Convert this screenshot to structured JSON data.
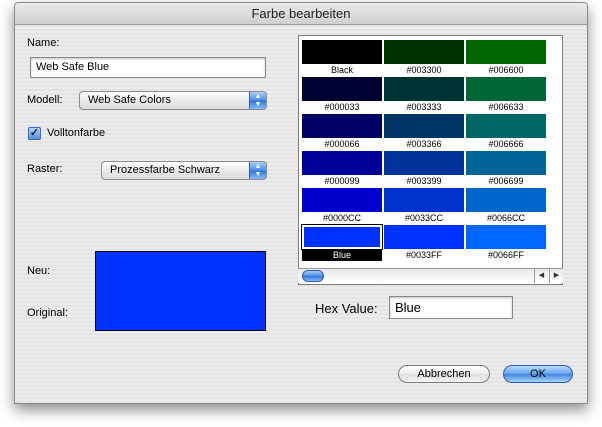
{
  "window": {
    "title": "Farbe bearbeiten"
  },
  "form": {
    "name_label": "Name:",
    "name_value": "Web Safe Blue",
    "model_label": "Modell:",
    "model_value": "Web Safe Colors",
    "solid_label": "Volltonfarbe",
    "solid_checked": true,
    "raster_label": "Raster:",
    "raster_value": "Prozessfarbe Schwarz"
  },
  "preview": {
    "new_label": "Neu:",
    "original_label": "Original:",
    "color": "#0033FF"
  },
  "palette": {
    "cells": [
      {
        "label": "Black",
        "color": "#000000"
      },
      {
        "label": "#003300",
        "color": "#003300"
      },
      {
        "label": "#006600",
        "color": "#006600"
      },
      {
        "label": "#000033",
        "color": "#000033"
      },
      {
        "label": "#003333",
        "color": "#003333"
      },
      {
        "label": "#006633",
        "color": "#006633"
      },
      {
        "label": "#000066",
        "color": "#000066"
      },
      {
        "label": "#003366",
        "color": "#003366"
      },
      {
        "label": "#006666",
        "color": "#006666"
      },
      {
        "label": "#000099",
        "color": "#000099"
      },
      {
        "label": "#003399",
        "color": "#003399"
      },
      {
        "label": "#006699",
        "color": "#006699"
      },
      {
        "label": "#0000CC",
        "color": "#0000CC"
      },
      {
        "label": "#0033CC",
        "color": "#0033CC"
      },
      {
        "label": "#0066CC",
        "color": "#0066CC"
      },
      {
        "label": "Blue",
        "color": "#0033FF",
        "selected": true
      },
      {
        "label": "#0033FF",
        "color": "#0033FF"
      },
      {
        "label": "#0066FF",
        "color": "#0066FF"
      }
    ]
  },
  "hex": {
    "label": "Hex Value:",
    "value": "Blue"
  },
  "buttons": {
    "cancel": "Abbrechen",
    "ok": "OK"
  },
  "icons": {
    "popup_arrows": "up-down-arrows-icon",
    "checkbox": "checkmark-icon",
    "scroll_left": "left-arrow-icon",
    "scroll_right": "right-arrow-icon"
  }
}
